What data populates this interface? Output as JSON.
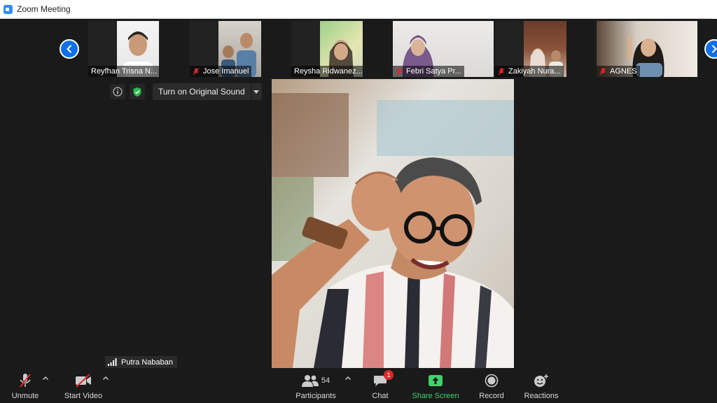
{
  "window": {
    "title": "Zoom Meeting"
  },
  "thumbnails": [
    {
      "name": "Reyfhan Trisna N...",
      "muted": false
    },
    {
      "name": "Jose Imanuel",
      "muted": true
    },
    {
      "name": "Reysha Ridwanez...",
      "muted": false
    },
    {
      "name": "Febri Satya Pr...",
      "muted": true
    },
    {
      "name": "Zakiyah Nura...",
      "muted": true
    },
    {
      "name": "AGNES",
      "muted": true
    }
  ],
  "audio": {
    "original_sound_label": "Turn on Original Sound"
  },
  "speaker": {
    "name": "Putra Nababan"
  },
  "toolbar": {
    "unmute_label": "Unmute",
    "start_video_label": "Start Video",
    "participants_label": "Participants",
    "participants_count": "54",
    "chat_label": "Chat",
    "chat_badge": "1",
    "share_screen_label": "Share Screen",
    "record_label": "Record",
    "reactions_label": "Reactions"
  },
  "colors": {
    "accent": "#0e71eb",
    "share": "#3fd36b",
    "muted_red": "#e02828"
  }
}
